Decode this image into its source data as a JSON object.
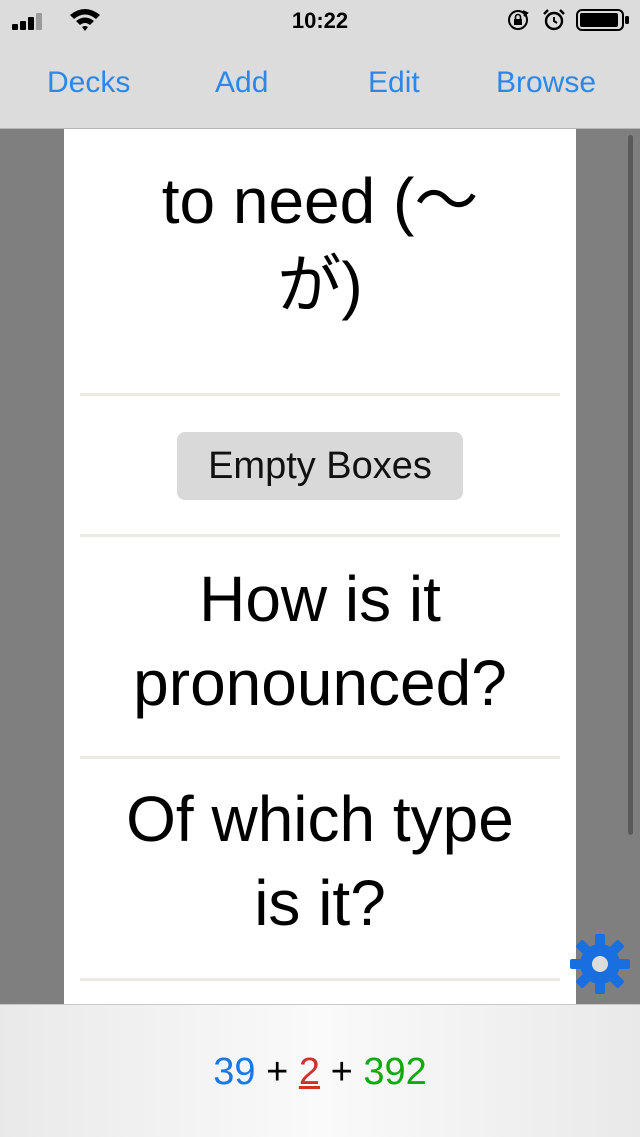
{
  "status_bar": {
    "time": "10:22",
    "icons": [
      "signal-icon",
      "wifi-icon",
      "rotation-lock-icon",
      "alarm-icon",
      "battery-icon"
    ]
  },
  "toolbar": {
    "decks_label": "Decks",
    "add_label": "Add",
    "edit_label": "Edit",
    "browse_label": "Browse",
    "accent_color": "#2c87e8"
  },
  "card": {
    "front_line1": "to need (〜",
    "front_line2": "が)",
    "empty_boxes_label": "Empty Boxes",
    "question1_line1": "How is it",
    "question1_line2": "pronounced?",
    "question2_line1": "Of which type",
    "question2_line2": "is it?"
  },
  "footer": {
    "new_count": "39",
    "learn_count": "2",
    "review_count": "392",
    "plus": "+",
    "colors": {
      "new": "#1a78e6",
      "learn": "#d32f2f",
      "review": "#0eaa0e"
    }
  },
  "settings_icon": "gear-icon"
}
